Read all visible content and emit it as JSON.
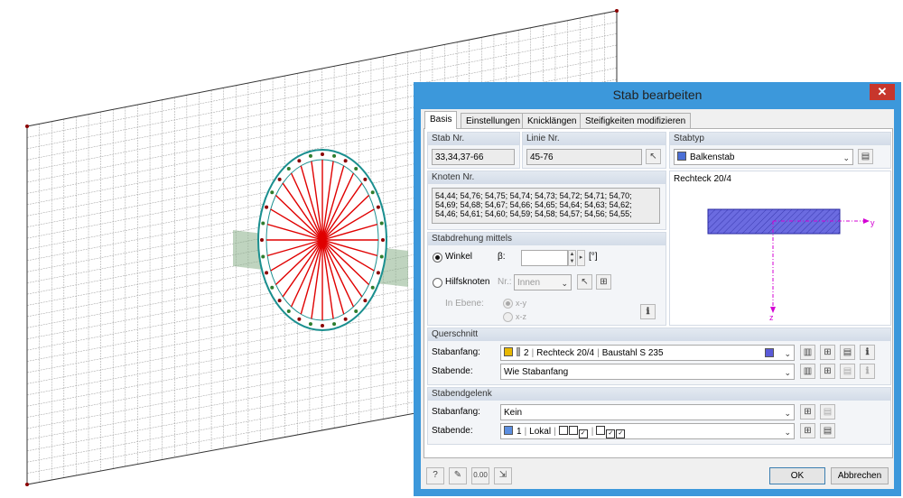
{
  "dialog": {
    "title": "Stab bearbeiten",
    "close_label": "✕",
    "tabs": [
      "Basis",
      "Einstellungen",
      "Knicklängen",
      "Steifigkeiten modifizieren"
    ],
    "stab_nr": {
      "label": "Stab Nr.",
      "value": "33,34,37-66"
    },
    "linie_nr": {
      "label": "Linie Nr.",
      "value": "45-76"
    },
    "stabtyp": {
      "label": "Stabtyp",
      "value": "Balkenstab",
      "color": "#4b6fd6"
    },
    "knoten": {
      "label": "Knoten Nr.",
      "lines": [
        "54,44; 54,76; 54,75; 54,74; 54,73; 54,72; 54,71; 54,70;",
        "54,69; 54,68; 54,67; 54,66; 54,65; 54,64; 54,63; 54,62;",
        "54,46; 54,61; 54,60; 54,59; 54,58; 54,57; 54,56; 54,55;"
      ]
    },
    "preview": {
      "label": "Rechteck 20/4",
      "axis_y": "y",
      "axis_z": "z"
    },
    "rotation": {
      "label": "Stabdrehung mittels",
      "winkel_label": "Winkel",
      "beta_label": "β:",
      "beta_value": "",
      "unit": "[°]",
      "hilfsknoten_label": "Hilfsknoten",
      "nr_label": "Nr.:",
      "nr_value": "Innen",
      "ebene_label": "In Ebene:",
      "xy": "x-y",
      "xz": "x-z"
    },
    "querschnitt": {
      "label": "Querschnitt",
      "anfang_label": "Stabanfang:",
      "anfang_num": "2",
      "anfang_name": "Rechteck 20/4",
      "anfang_mat": "Baustahl S 235",
      "anfang_color": "#e8b800",
      "ende_label": "Stabende:",
      "ende_value": "Wie Stabanfang"
    },
    "gelenk": {
      "label": "Stabendgelenk",
      "anfang_label": "Stabanfang:",
      "anfang_value": "Kein",
      "ende_label": "Stabende:",
      "ende_num": "1",
      "ende_sys": "Lokal",
      "ende_color": "#5b8ee0"
    },
    "ok_label": "OK",
    "cancel_label": "Abbrechen"
  },
  "colors": {
    "mesh": "#808080",
    "spokes": "#e00000",
    "ring": "#1a8f8f",
    "surface_band": "#8ab08a",
    "section_fill": "#5a5ad8",
    "title_bar": "#3c98db"
  }
}
